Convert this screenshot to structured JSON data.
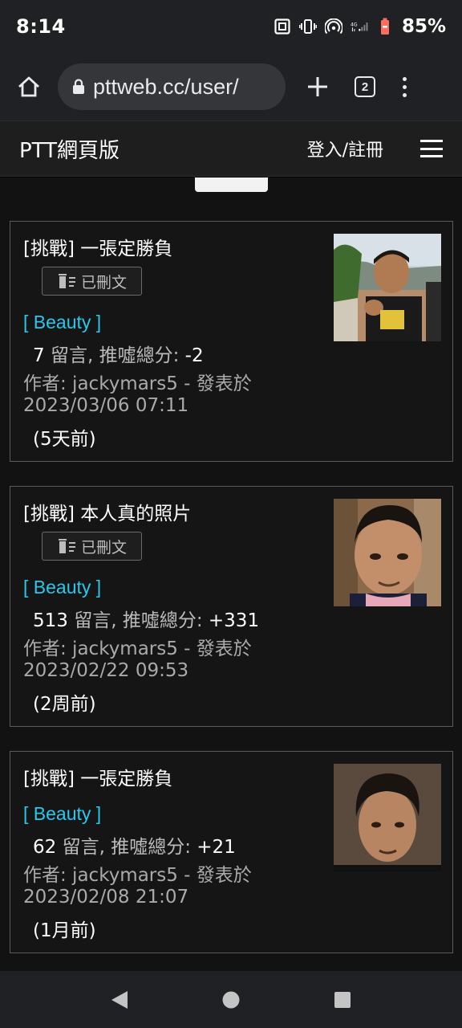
{
  "status": {
    "time": "8:14",
    "battery": "85%",
    "icons": [
      "nfc-icon",
      "vibrate-icon",
      "hotspot-icon",
      "4g-signal-icon",
      "battery-icon"
    ]
  },
  "browser": {
    "url": "pttweb.cc/user/",
    "tab_count": "2"
  },
  "header": {
    "title": "PTT網頁版",
    "login": "登入/註冊"
  },
  "posts": [
    {
      "title": "[挑戰] 一張定勝負",
      "deleted_label": "已刪文",
      "board": "[ Beauty ]",
      "comment_count": "7",
      "stats_label": " 留言, 推噓總分: ",
      "score": "-2",
      "author": "作者: jackymars5 - 發表於",
      "date": "2023/03/06 07:11",
      "ago": "(5天前)"
    },
    {
      "title": "[挑戰] 本人真的照片",
      "deleted_label": "已刪文",
      "board": "[ Beauty ]",
      "comment_count": "513",
      "stats_label": " 留言, 推噓總分: ",
      "score": "+331",
      "author": "作者: jackymars5 - 發表於",
      "date": "2023/02/22 09:53",
      "ago": "(2周前)"
    },
    {
      "title": "[挑戰] 一張定勝負",
      "board": "[ Beauty ]",
      "comment_count": "62",
      "stats_label": " 留言, 推噓總分: ",
      "score": "+21",
      "author": "作者: jackymars5 - 發表於",
      "date": "2023/02/08 21:07",
      "ago": "(1月前)"
    }
  ]
}
